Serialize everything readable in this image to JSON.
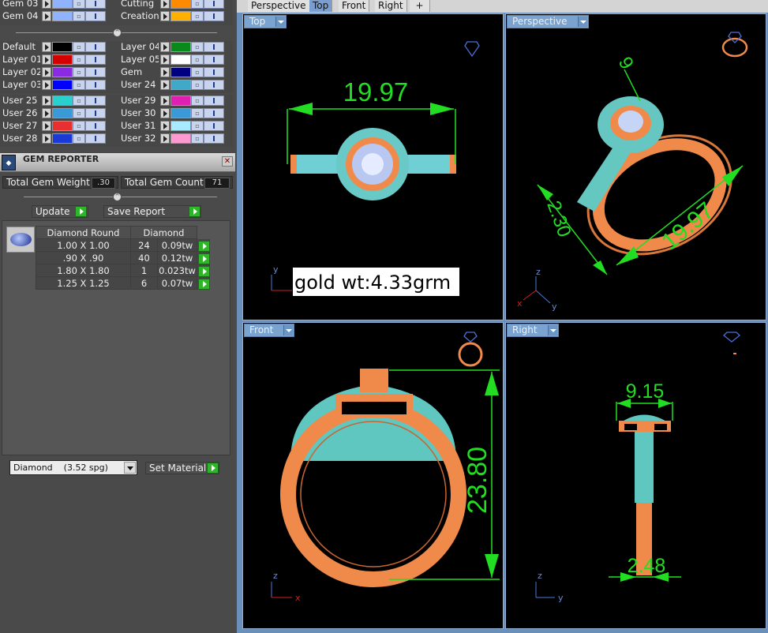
{
  "layers_top": [
    {
      "name": "Gem 03",
      "color": "#8fb3ff"
    },
    {
      "name": "Cutting",
      "color": "#ff8a00"
    },
    {
      "name": "Gem 04",
      "color": "#8fb3ff"
    },
    {
      "name": "Creation",
      "color": "#ffb000"
    }
  ],
  "layers_mid": [
    {
      "name": "Default",
      "color": "#000000"
    },
    {
      "name": "Layer 04",
      "color": "#0a8a1a"
    },
    {
      "name": "Layer 01",
      "color": "#d40000"
    },
    {
      "name": "Layer 05",
      "color": "#ffffff"
    },
    {
      "name": "Layer 02",
      "color": "#8a2be2"
    },
    {
      "name": "Gem",
      "color": "#000080"
    },
    {
      "name": "Layer 03",
      "color": "#0000ff"
    },
    {
      "name": "User 24",
      "color": "#40a8c8"
    }
  ],
  "layers_user": [
    {
      "name": "User 25",
      "color": "#28d0d0"
    },
    {
      "name": "User 29",
      "color": "#e020b0"
    },
    {
      "name": "User 26",
      "color": "#3a9ad8"
    },
    {
      "name": "User 30",
      "color": "#3a9ad8"
    },
    {
      "name": "User 27",
      "color": "#e83030"
    },
    {
      "name": "User 31",
      "color": "#a8eaff"
    },
    {
      "name": "User 28",
      "color": "#1a3ad8"
    },
    {
      "name": "User 32",
      "color": "#ff9ad0"
    }
  ],
  "gem_reporter": {
    "title": "GEM REPORTER",
    "close": "✕",
    "total_weight_label": "Total Gem Weight",
    "total_weight_value": ".30",
    "total_count_label": "Total Gem Count",
    "total_count_value": "71",
    "update_label": "Update",
    "save_label": "Save Report",
    "col_shape": "Diamond Round",
    "col_material": "Diamond",
    "rows": [
      {
        "size": "1.00 X 1.00",
        "count": "24",
        "weight": "0.09tw"
      },
      {
        "size": ".90 X .90",
        "count": "40",
        "weight": "0.12tw"
      },
      {
        "size": "1.80 X 1.80",
        "count": "1",
        "weight": "0.023tw"
      },
      {
        "size": "1.25 X 1.25",
        "count": "6",
        "weight": "0.07tw"
      }
    ],
    "material_select": "Diamond    (3.52 spg)",
    "set_material_label": "Set Material"
  },
  "tabs": [
    "Perspective",
    "Top",
    "Front",
    "Right",
    "+"
  ],
  "active_tab": "Top",
  "viewports": {
    "top": {
      "label": "Top",
      "dimension": "19.97",
      "note": "gold wt:4.33grm",
      "axis_a": "y",
      "axis_b": "x"
    },
    "perspective": {
      "label": "Perspective",
      "dim_a": "19.97",
      "dim_b": "2.30",
      "dim_c": "9",
      "axis_a": "z",
      "axis_b": "y",
      "axis_c": "x"
    },
    "front": {
      "label": "Front",
      "dimension": "23.80",
      "axis_a": "z",
      "axis_b": "x"
    },
    "right": {
      "label": "Right",
      "dim_top": "9.15",
      "dim_bottom": "2.48",
      "axis_a": "z",
      "axis_b": "y"
    }
  },
  "colors": {
    "gold": "#f08a4b",
    "gem": "#4fd0c8",
    "dim": "#22dd22",
    "axis_red": "#d02020",
    "axis_blue": "#4a7ad8"
  }
}
